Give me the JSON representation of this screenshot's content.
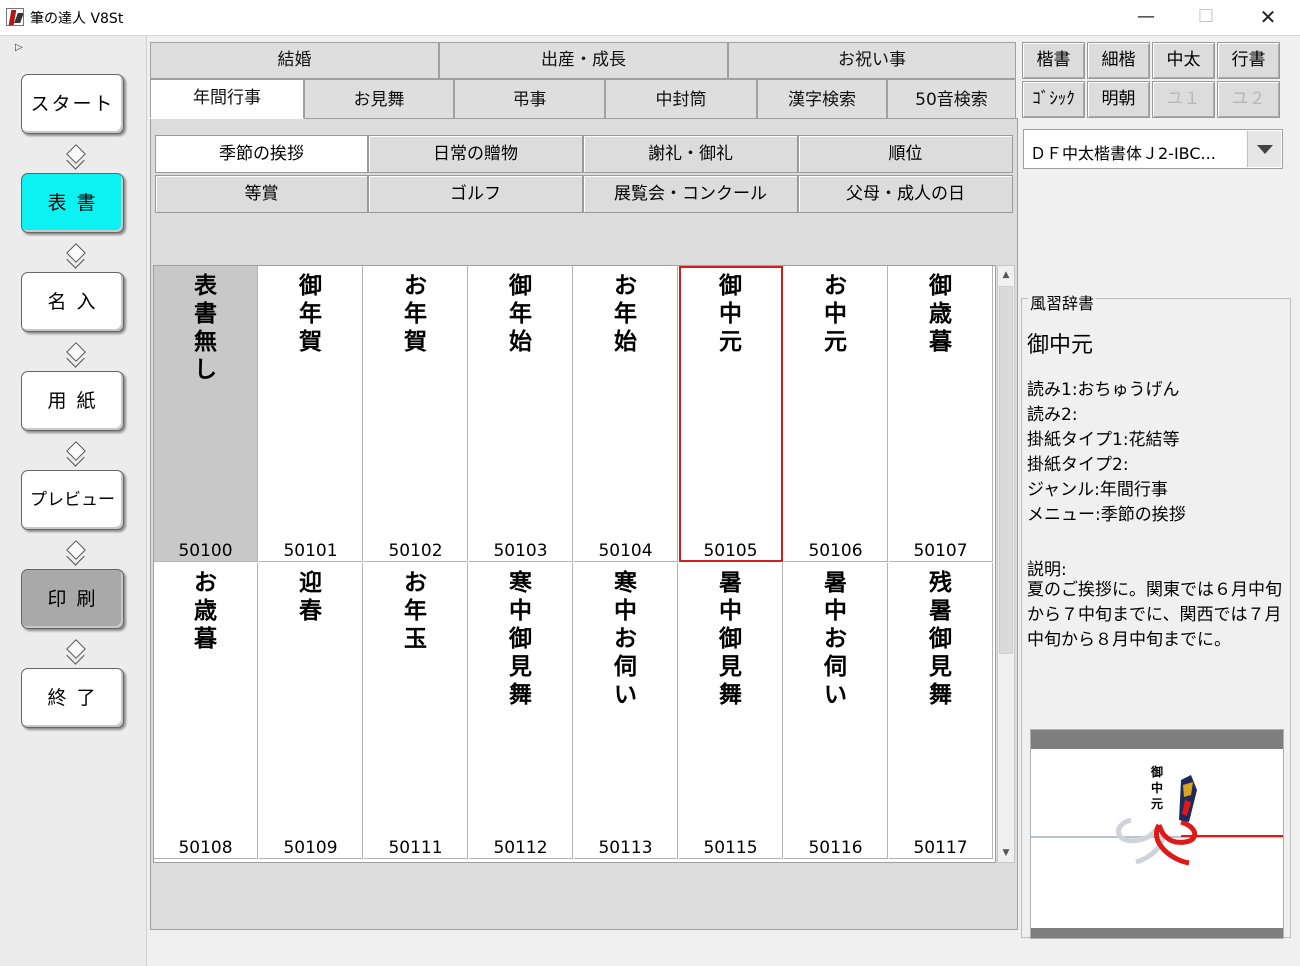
{
  "window": {
    "title": "筆の達人 V8St",
    "min": "—",
    "max": "☐",
    "close": "✕"
  },
  "sidebar": {
    "marker": "▷",
    "buttons": [
      {
        "label": "スタート"
      },
      {
        "label": "表 書"
      },
      {
        "label": "名 入"
      },
      {
        "label": "用 紙"
      },
      {
        "label": "プレビュー"
      },
      {
        "label": "印 刷"
      },
      {
        "label": "終 了"
      }
    ]
  },
  "top_tabs_row1": [
    "結婚",
    "出産・成長",
    "お祝い事"
  ],
  "top_tabs_row2": [
    "年間行事",
    "お見舞",
    "弔事",
    "中封筒",
    "漢字検索",
    "50音検索"
  ],
  "subtabs": [
    [
      "季節の挨拶",
      "日常の贈物",
      "謝礼・御礼",
      "順位"
    ],
    [
      "等賞",
      "ゴルフ",
      "展覧会・コンクール",
      "父母・成人の日"
    ]
  ],
  "grid": [
    {
      "text": "表書無し",
      "code": "50100"
    },
    {
      "text": "御年賀",
      "code": "50101"
    },
    {
      "text": "お年賀",
      "code": "50102"
    },
    {
      "text": "御年始",
      "code": "50103"
    },
    {
      "text": "お年始",
      "code": "50104"
    },
    {
      "text": "御中元",
      "code": "50105"
    },
    {
      "text": "お中元",
      "code": "50106"
    },
    {
      "text": "御歳暮",
      "code": "50107"
    },
    {
      "text": "お歳暮",
      "code": "50108"
    },
    {
      "text": "迎春",
      "code": "50109"
    },
    {
      "text": "お年玉",
      "code": "50111"
    },
    {
      "text": "寒中御見舞",
      "code": "50112"
    },
    {
      "text": "寒中お伺い",
      "code": "50113"
    },
    {
      "text": "暑中御見舞",
      "code": "50115"
    },
    {
      "text": "暑中お伺い",
      "code": "50116"
    },
    {
      "text": "残暑御見舞",
      "code": "50117"
    }
  ],
  "font_buttons": {
    "row1": [
      "楷書",
      "細楷",
      "中太",
      "行書"
    ],
    "row2": [
      "ｺﾞｼｯｸ",
      "明朝",
      "ユ１",
      "ユ２"
    ]
  },
  "font_select": {
    "value": "ＤＦ中太楷書体Ｊ2-IBC..."
  },
  "dictionary": {
    "label": "風習辞書",
    "word": "御中元",
    "lines": [
      "読み1:おちゅうげん",
      "読み2:",
      "掛紙タイプ1:花結等",
      "掛紙タイプ2:",
      "ジャンル:年間行事",
      "メニュー:季節の挨拶"
    ],
    "desc_label": "説明:",
    "desc": "夏のご挨拶に。関東では６月中旬から７中旬までに、関西では７月中旬から８月中旬までに。"
  },
  "preview": {
    "text": "御中元"
  },
  "colors": {
    "active_button": "#0cf2f2",
    "selected_border": "#d21e1e",
    "noshi_red": "#e01818"
  }
}
